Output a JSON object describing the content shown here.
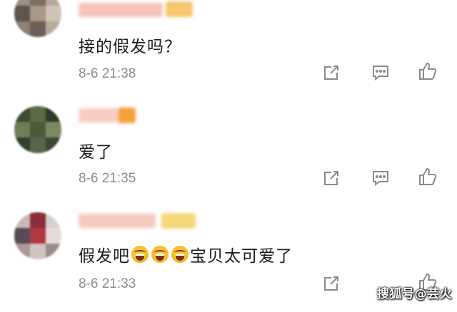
{
  "comments": [
    {
      "text": "接的假发吗？",
      "time": "8-6 21:38",
      "colors": {
        "avatar": [
          "#9c8f84",
          "#7b6e62",
          "#b7a79a",
          "#5f554c",
          "#a89888",
          "#cfc3b6"
        ],
        "name": "#f4b9b0",
        "badge": "#f6c56e"
      }
    },
    {
      "text": "爱了",
      "time": "8-6 21:35",
      "colors": {
        "avatar": [
          "#3f4a35",
          "#5b6b44",
          "#2f3a2a",
          "#6f7f55",
          "#4a5a3b",
          "#7d8b63"
        ],
        "name": "#f8c3b8",
        "badge": "#f3a23b"
      }
    },
    {
      "text_parts": [
        "假发吧",
        "宝贝太可爱了"
      ],
      "emoji": [
        "grinning-squinting-face",
        "grinning-squinting-face",
        "grinning-squinting-face"
      ],
      "time": "8-6 21:33",
      "colors": {
        "avatar": [
          "#c9b8b3",
          "#8b2d3a",
          "#d8d0cc",
          "#5a4a55",
          "#b03a44",
          "#e5dcd8"
        ],
        "name": "#f6c0b2",
        "badge": "#f6d77a"
      }
    }
  ],
  "actions": {
    "icons": [
      "share-icon",
      "comment-icon",
      "like-icon"
    ],
    "color": "#8a8a8a"
  },
  "watermark": "搜狐号@芸火"
}
